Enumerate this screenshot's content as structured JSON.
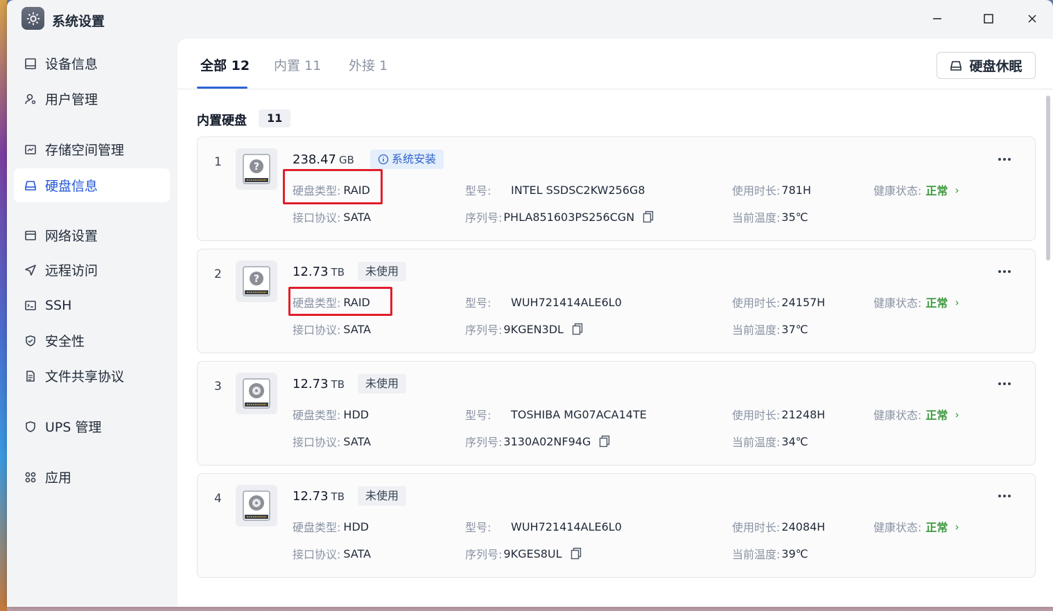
{
  "window": {
    "title": "系统设置"
  },
  "sidebar": {
    "items": [
      {
        "label": "设备信息",
        "icon": "monitor-icon"
      },
      {
        "label": "用户管理",
        "icon": "user-gear-icon"
      },
      {
        "label": "存储空间管理",
        "icon": "storage-icon"
      },
      {
        "label": "硬盘信息",
        "icon": "drive-icon",
        "active": true
      },
      {
        "label": "网络设置",
        "icon": "network-icon"
      },
      {
        "label": "远程访问",
        "icon": "send-icon"
      },
      {
        "label": "SSH",
        "icon": "terminal-icon"
      },
      {
        "label": "安全性",
        "icon": "shield-check-icon"
      },
      {
        "label": "文件共享协议",
        "icon": "document-icon"
      },
      {
        "label": "UPS 管理",
        "icon": "shield-icon"
      },
      {
        "label": "应用",
        "icon": "apps-icon"
      }
    ]
  },
  "tabs": [
    {
      "label": "全部",
      "count": "12",
      "active": true
    },
    {
      "label": "内置",
      "count": "11"
    },
    {
      "label": "外接",
      "count": "1"
    }
  ],
  "toolbar": {
    "sleep_label": "硬盘休眠"
  },
  "section": {
    "title": "内置硬盘",
    "count": "11"
  },
  "labels": {
    "disk_type": "硬盘类型:",
    "interface": "接口协议:",
    "model": "型号:",
    "serial": "序列号:",
    "usage": "使用时长:",
    "temp": "当前温度:",
    "health": "健康状态:"
  },
  "disks": [
    {
      "index": "1",
      "size": "238.47",
      "unit": "GB",
      "badge": "系统安装",
      "type": "RAID",
      "interface": "SATA",
      "model": "INTEL SSDSC2KW256G8",
      "serial": "PHLA851603PS256CGN",
      "usage": "781H",
      "temp": "35℃",
      "health": "正常",
      "icon": "question-disk-icon"
    },
    {
      "index": "2",
      "size": "12.73",
      "unit": "TB",
      "badge": "未使用",
      "type": "RAID",
      "interface": "SATA",
      "model": "WUH721414ALE6L0",
      "serial": "9KGEN3DL",
      "usage": "24157H",
      "temp": "37℃",
      "health": "正常",
      "icon": "question-disk-icon"
    },
    {
      "index": "3",
      "size": "12.73",
      "unit": "TB",
      "badge": "未使用",
      "type": "HDD",
      "interface": "SATA",
      "model": "TOSHIBA MG07ACA14TE",
      "serial": "3130A02NF94G",
      "usage": "21248H",
      "temp": "34℃",
      "health": "正常",
      "icon": "hdd-icon"
    },
    {
      "index": "4",
      "size": "12.73",
      "unit": "TB",
      "badge": "未使用",
      "type": "HDD",
      "interface": "SATA",
      "model": "WUH721414ALE6L0",
      "serial": "9KGES8UL",
      "usage": "24084H",
      "temp": "39℃",
      "health": "正常",
      "icon": "hdd-icon"
    }
  ],
  "colors": {
    "accent": "#2a63d6",
    "health_ok": "#3f9a3f",
    "highlight": "#e11d2a"
  }
}
